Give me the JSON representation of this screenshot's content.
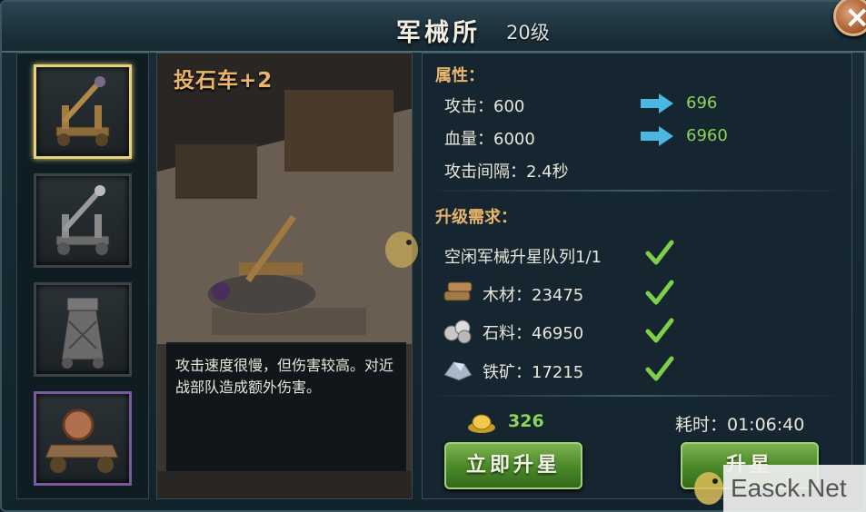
{
  "window": {
    "title": "军械所",
    "level": "20级"
  },
  "units": [
    {
      "name": "catapult-plus2",
      "selected": true
    },
    {
      "name": "catapult",
      "selected": false
    },
    {
      "name": "siege-tower",
      "selected": false
    },
    {
      "name": "battering-cart",
      "selected": false
    }
  ],
  "preview": {
    "unit_name": "投石车+2",
    "description": "攻击速度很慢，但伤害较高。对近战部队造成额外伤害。"
  },
  "attributes": {
    "title": "属性：",
    "attack": {
      "label": "攻击：600",
      "new": "696"
    },
    "hp": {
      "label": "血量：6000",
      "new": "6960"
    },
    "interval": {
      "label": "攻击间隔：2.4秒"
    }
  },
  "requirements": {
    "title": "升级需求：",
    "queue": "空闲军械升星队列1/1",
    "wood": "木材：23475",
    "stone": "石料：46950",
    "iron": "铁矿：17215"
  },
  "cost": {
    "gold": "326",
    "time": "耗时：01:06:40"
  },
  "buttons": {
    "instant": "立即升星",
    "upgrade": "升星"
  },
  "watermark": "Easck.Net",
  "colors": {
    "gold_text": "#e8b56a",
    "green_value": "#8ed25a",
    "selected_border": "#e6d27a",
    "button_green": "#4c8a2a"
  }
}
